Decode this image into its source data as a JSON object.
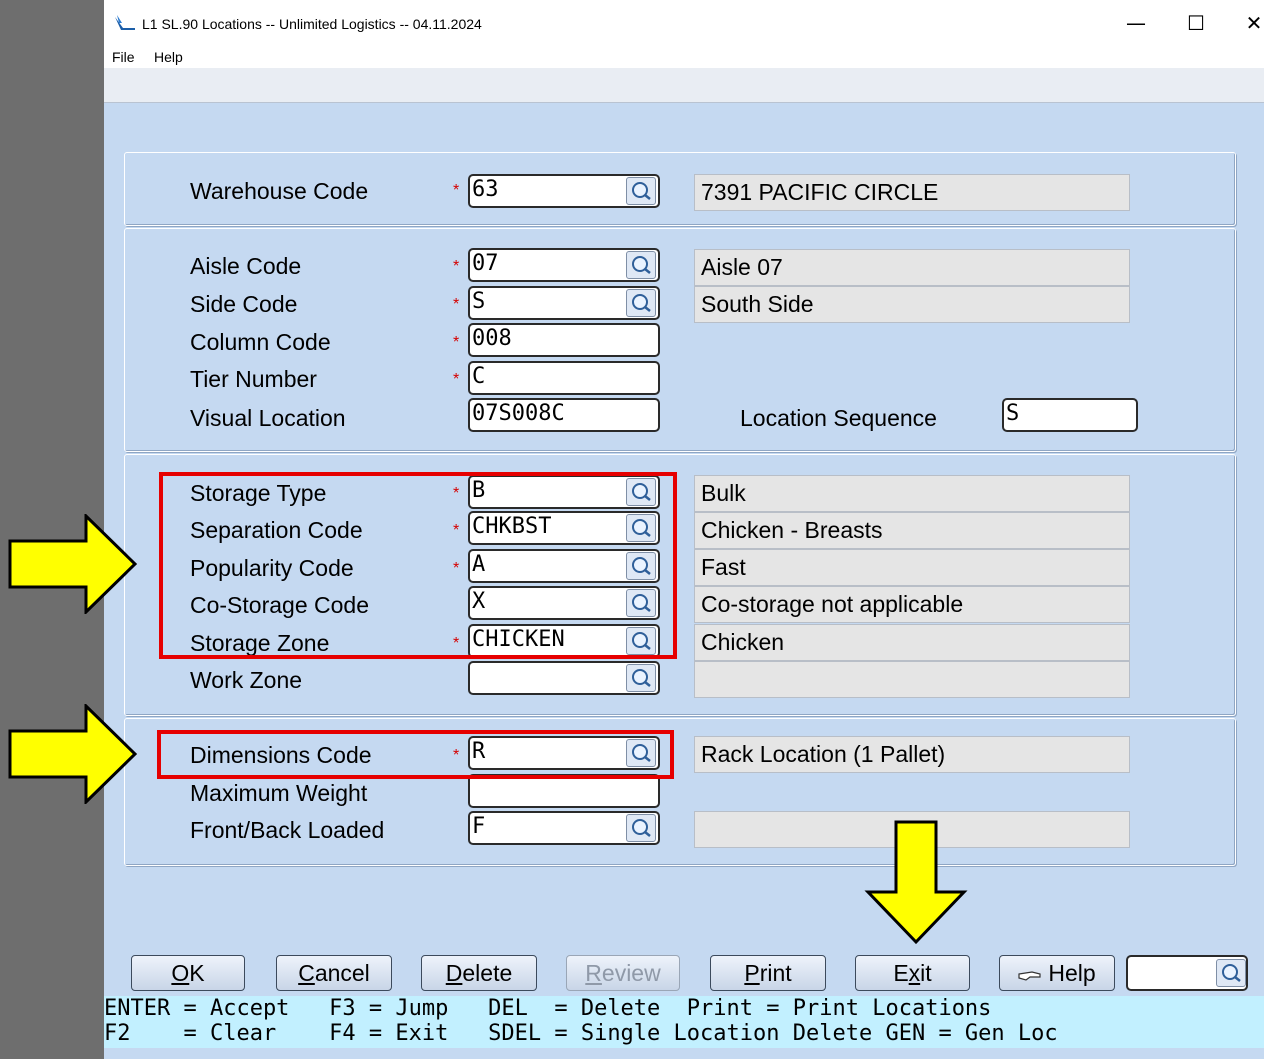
{
  "window": {
    "title": "L1 SL.90 Locations -- Unlimited Logistics -- 04.11.2024",
    "minimize": "—",
    "maximize": "☐",
    "close": "✕"
  },
  "menu": [
    "File",
    "Help"
  ],
  "form": {
    "warehouse": {
      "label": "Warehouse Code",
      "value": "63",
      "desc": "7391 PACIFIC CIRCLE"
    },
    "aisle": {
      "label": "Aisle Code",
      "value": "07",
      "desc": "Aisle 07"
    },
    "side": {
      "label": "Side Code",
      "value": "S",
      "desc": "South Side"
    },
    "column": {
      "label": "Column Code",
      "value": "008"
    },
    "tier": {
      "label": "Tier Number",
      "value": "C"
    },
    "visual": {
      "label": "Visual Location",
      "value": "07S008C"
    },
    "sequence": {
      "label": "Location Sequence",
      "value": "S"
    },
    "storage_type": {
      "label": "Storage Type",
      "value": "B",
      "desc": "Bulk"
    },
    "separation": {
      "label": "Separation Code",
      "value": "CHKBST",
      "desc": "Chicken - Breasts"
    },
    "popularity": {
      "label": "Popularity Code",
      "value": "A",
      "desc": "Fast"
    },
    "co_storage": {
      "label": "Co-Storage Code",
      "value": "X",
      "desc": "Co-storage not applicable"
    },
    "storage_zone": {
      "label": "Storage Zone",
      "value": "CHICKEN",
      "desc": "Chicken"
    },
    "work_zone": {
      "label": "Work Zone",
      "value": "",
      "desc": ""
    },
    "dimensions": {
      "label": "Dimensions Code",
      "value": "R",
      "desc": "Rack Location (1 Pallet)"
    },
    "max_weight": {
      "label": "Maximum Weight",
      "value": ""
    },
    "front_back": {
      "label": "Front/Back Loaded",
      "value": "F",
      "desc": ""
    },
    "required_mark": "*"
  },
  "buttons": {
    "ok": {
      "key": "O",
      "rest": "K"
    },
    "cancel": {
      "key": "C",
      "rest": "ancel"
    },
    "delete": {
      "key": "D",
      "rest": "elete"
    },
    "review": {
      "key": "R",
      "rest": "eview"
    },
    "print": {
      "key": "P",
      "rest": "rint"
    },
    "exit": {
      "pre": "E",
      "key": "x",
      "rest": "it"
    },
    "help": "Help",
    "search_value": ""
  },
  "hints": {
    "line1": "ENTER = Accept   F3 = Jump   DEL  = Delete  Print = Print Locations",
    "line2": "F2    = Clear    F4 = Exit   SDEL = Single Location Delete GEN = Gen Loc"
  },
  "colors": {
    "form_bg": "#c5d9f1",
    "highlight_box": "#e60000",
    "annotation_arrow": "#ffff00",
    "hint_bar": "#c2f0ff"
  }
}
